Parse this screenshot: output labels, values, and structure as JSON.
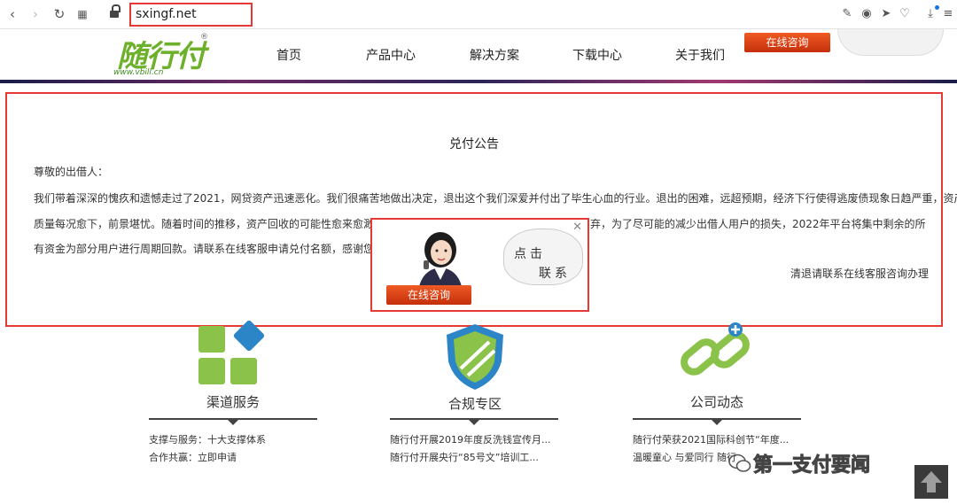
{
  "browser": {
    "url": "sxingf.net",
    "icons": [
      "back-icon",
      "forward-icon",
      "reload-icon",
      "apps-icon",
      "lock-icon",
      "edit-icon",
      "camera-icon",
      "send-icon",
      "heart-icon",
      "download-icon",
      "menu-icon"
    ]
  },
  "header": {
    "logo_text": "随行付",
    "logo_reg": "®",
    "logo_url": "www.vbill.cn",
    "menu": [
      "首页",
      "产品中心",
      "解决方案",
      "下载中心",
      "关于我们"
    ],
    "consult_button": "在线咨询"
  },
  "notice": {
    "title": "兑付公告",
    "greeting": "尊敬的出借人：",
    "line1": "我们带着深深的愧疚和遗憾走过了2021，网贷资产迅速恶化。我们很痛苦地做出决定，退出这个我们深爱并付出了毕生心血的行业。退出的困难，远超预期，经济下行使得逃废债现象日趋严重，资产",
    "line2a": "质量每况愈下，前景堪忧。随着时间的推移，资产回收的可能性愈来愈渺茫，但",
    "line2b": "弃，为了尽可能的减少出借人用户的损失，2022年平台将集中剩余的所",
    "line3": "有资金为部分用户进行周期回款。请联系在线客服申请兑付名额，感谢您一如既",
    "note": "清退请联系在线客服咨询办理"
  },
  "popup": {
    "bubble_line1": "点击",
    "bubble_line2": "联系",
    "button": "在线咨询",
    "close": "✕"
  },
  "columns": [
    {
      "title": "渠道服务",
      "links": [
        "支撑与服务：十大支撑体系",
        "合作共赢：立即申请"
      ]
    },
    {
      "title": "合规专区",
      "links": [
        "随行付开展2019年度反洗钱宣传月...",
        "随行付开展央行“85号文”培训工..."
      ]
    },
    {
      "title": "公司动态",
      "links": [
        "随行付荣获2021国际科创节“年度...",
        "温暖童心 与爱同行 随行"
      ]
    }
  ],
  "watermark": "第一支付要闻",
  "colors": {
    "accent_red": "#e53935",
    "brand_green": "#6db12b",
    "button_orange": "#e14a1a",
    "shield_blue": "#2b85c6"
  }
}
